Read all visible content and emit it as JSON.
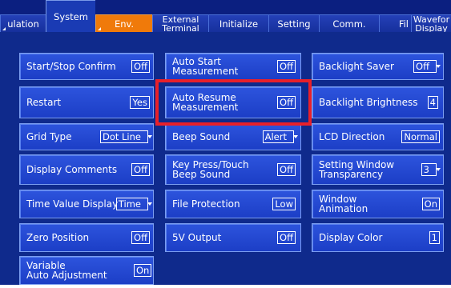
{
  "tabs": [
    {
      "label": "ulation"
    },
    {
      "label": "System"
    },
    {
      "label": "Env."
    },
    {
      "label_line1": "External",
      "label_line2": "Terminal"
    },
    {
      "label": "Initialize"
    },
    {
      "label": "Setting"
    },
    {
      "label": "Comm."
    },
    {
      "label": "Fil"
    },
    {
      "label_line1": "Wavefor",
      "label_line2": "Display"
    }
  ],
  "col1": [
    {
      "label": "Start/Stop Confirm",
      "value": "Off"
    },
    {
      "label": "Restart",
      "value": "Yes"
    },
    {
      "label": "Grid Type",
      "value": "Dot Line"
    },
    {
      "label": "Display Comments",
      "value": "Off"
    },
    {
      "label": "Time Value Display",
      "value": "Time"
    },
    {
      "label": "Zero Position",
      "value": "Off"
    },
    {
      "label_line1": "Variable",
      "label_line2": "Auto Adjustment",
      "value": "On"
    }
  ],
  "col2": [
    {
      "label_line1": "Auto Start",
      "label_line2": "Measurement",
      "value": "Off"
    },
    {
      "label_line1": "Auto Resume",
      "label_line2": "Measurement",
      "value": "Off"
    },
    {
      "label": "Beep Sound",
      "value": "Alert"
    },
    {
      "label_line1": "Key Press/Touch",
      "label_line2": "Beep Sound",
      "value": "Off"
    },
    {
      "label": "File Protection",
      "value": "Low"
    },
    {
      "label": "5V Output",
      "value": "Off"
    }
  ],
  "col3": [
    {
      "label": "Backlight Saver",
      "value": "Off"
    },
    {
      "label": "Backlight Brightness",
      "value": "4"
    },
    {
      "label": "LCD Direction",
      "value": "Normal"
    },
    {
      "label_line1": "Setting Window",
      "label_line2": "Transparency",
      "value": "3"
    },
    {
      "label_line1": "Window",
      "label_line2": "Animation",
      "value": "On"
    },
    {
      "label": "Display Color",
      "value": "1"
    }
  ],
  "colors": {
    "accent_tab": "#f07a0a",
    "highlight": "#e8202a",
    "panel": "#0f2a8c"
  }
}
